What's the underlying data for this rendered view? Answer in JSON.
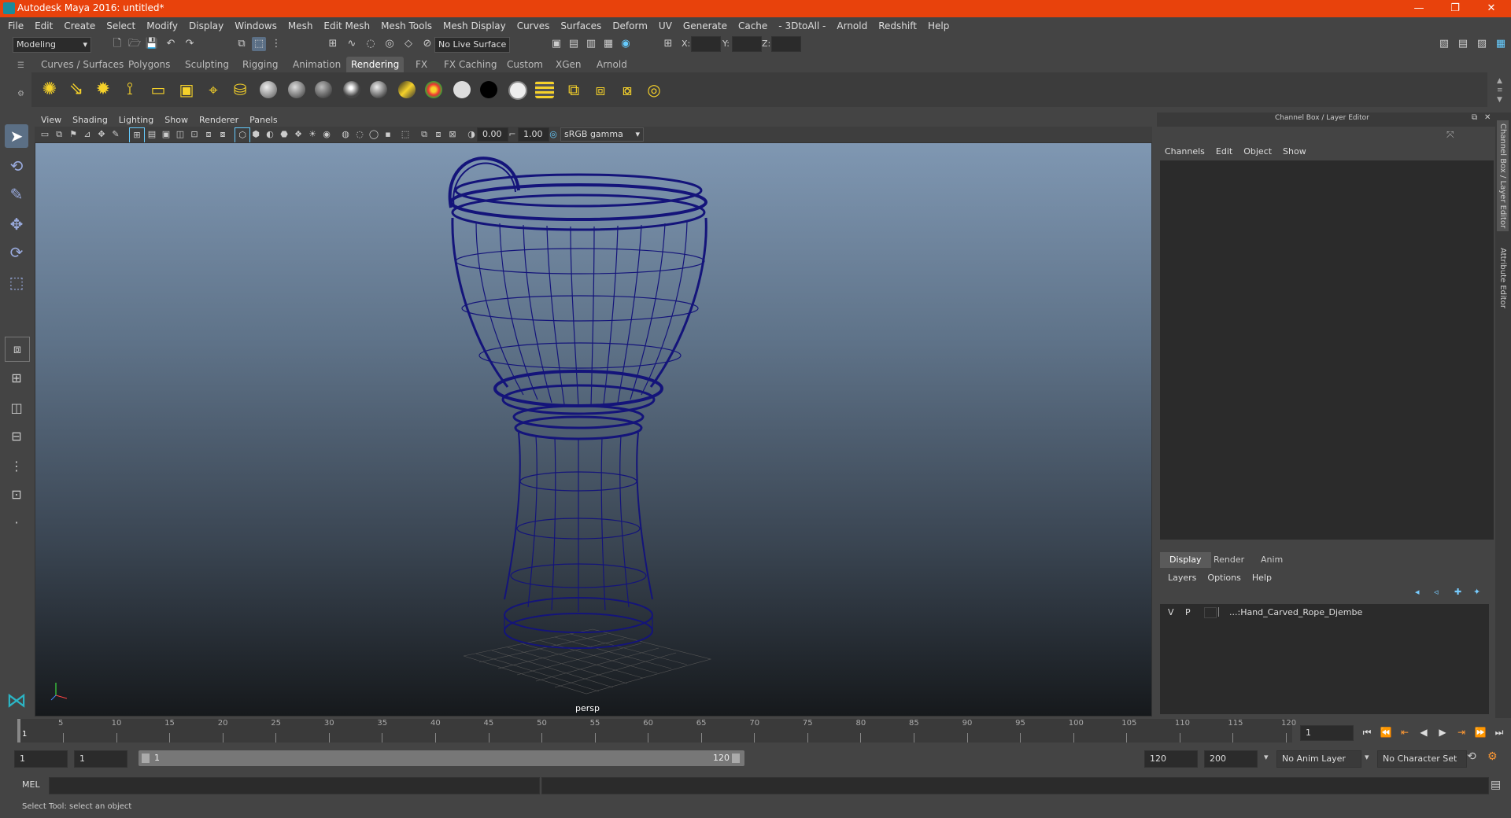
{
  "window": {
    "title": "Autodesk Maya 2016: untitled*",
    "minimize": "—",
    "restore": "❐",
    "close": "✕"
  },
  "menubar": [
    "File",
    "Edit",
    "Create",
    "Select",
    "Modify",
    "Display",
    "Windows",
    "Mesh",
    "Edit Mesh",
    "Mesh Tools",
    "Mesh Display",
    "Curves",
    "Surfaces",
    "Deform",
    "UV",
    "Generate",
    "Cache",
    "- 3DtoAll -",
    "Arnold",
    "Redshift",
    "Help"
  ],
  "status_line": {
    "mode": "Modeling",
    "live_surface": "No Live Surface",
    "x_label": "X:",
    "y_label": "Y:",
    "z_label": "Z:"
  },
  "shelf_tabs": [
    "Curves / Surfaces",
    "Polygons",
    "Sculpting",
    "Rigging",
    "Animation",
    "Rendering",
    "FX",
    "FX Caching",
    "Custom",
    "XGen",
    "Arnold"
  ],
  "active_shelf": "Rendering",
  "viewport": {
    "menu": [
      "View",
      "Shading",
      "Lighting",
      "Show",
      "Renderer",
      "Panels"
    ],
    "exposure": "0.00",
    "gamma": "1.00",
    "color_space": "sRGB gamma",
    "camera": "persp",
    "wire_color": "#1a1a8a"
  },
  "channel_box": {
    "title": "Channel Box / Layer Editor",
    "menu": [
      "Channels",
      "Edit",
      "Object",
      "Show"
    ]
  },
  "layer_editor": {
    "tabs": [
      "Display",
      "Render",
      "Anim"
    ],
    "active_tab": "Display",
    "menu": [
      "Layers",
      "Options",
      "Help"
    ],
    "layers": [
      {
        "v": "V",
        "p": "P",
        "name": "...:Hand_Carved_Rope_Djembe"
      }
    ]
  },
  "side_tabs": [
    "Channel Box / Layer Editor",
    "Attribute Editor"
  ],
  "timeline": {
    "ticks": [
      "1",
      "5",
      "10",
      "15",
      "20",
      "25",
      "30",
      "35",
      "40",
      "45",
      "50",
      "55",
      "60",
      "65",
      "70",
      "75",
      "80",
      "85",
      "90",
      "95",
      "100",
      "105",
      "110",
      "115",
      "120"
    ],
    "current_frame": "1"
  },
  "range": {
    "start": "1",
    "playback_start": "1",
    "slider_start": "1",
    "slider_end": "120",
    "playback_end": "120",
    "end": "200",
    "anim_layer": "No Anim Layer",
    "character_set": "No Character Set"
  },
  "command_line": {
    "lang": "MEL"
  },
  "help_line": "Select Tool: select an object",
  "colors": {
    "title_bar": "#e8420c",
    "ui_bg": "#444444"
  }
}
